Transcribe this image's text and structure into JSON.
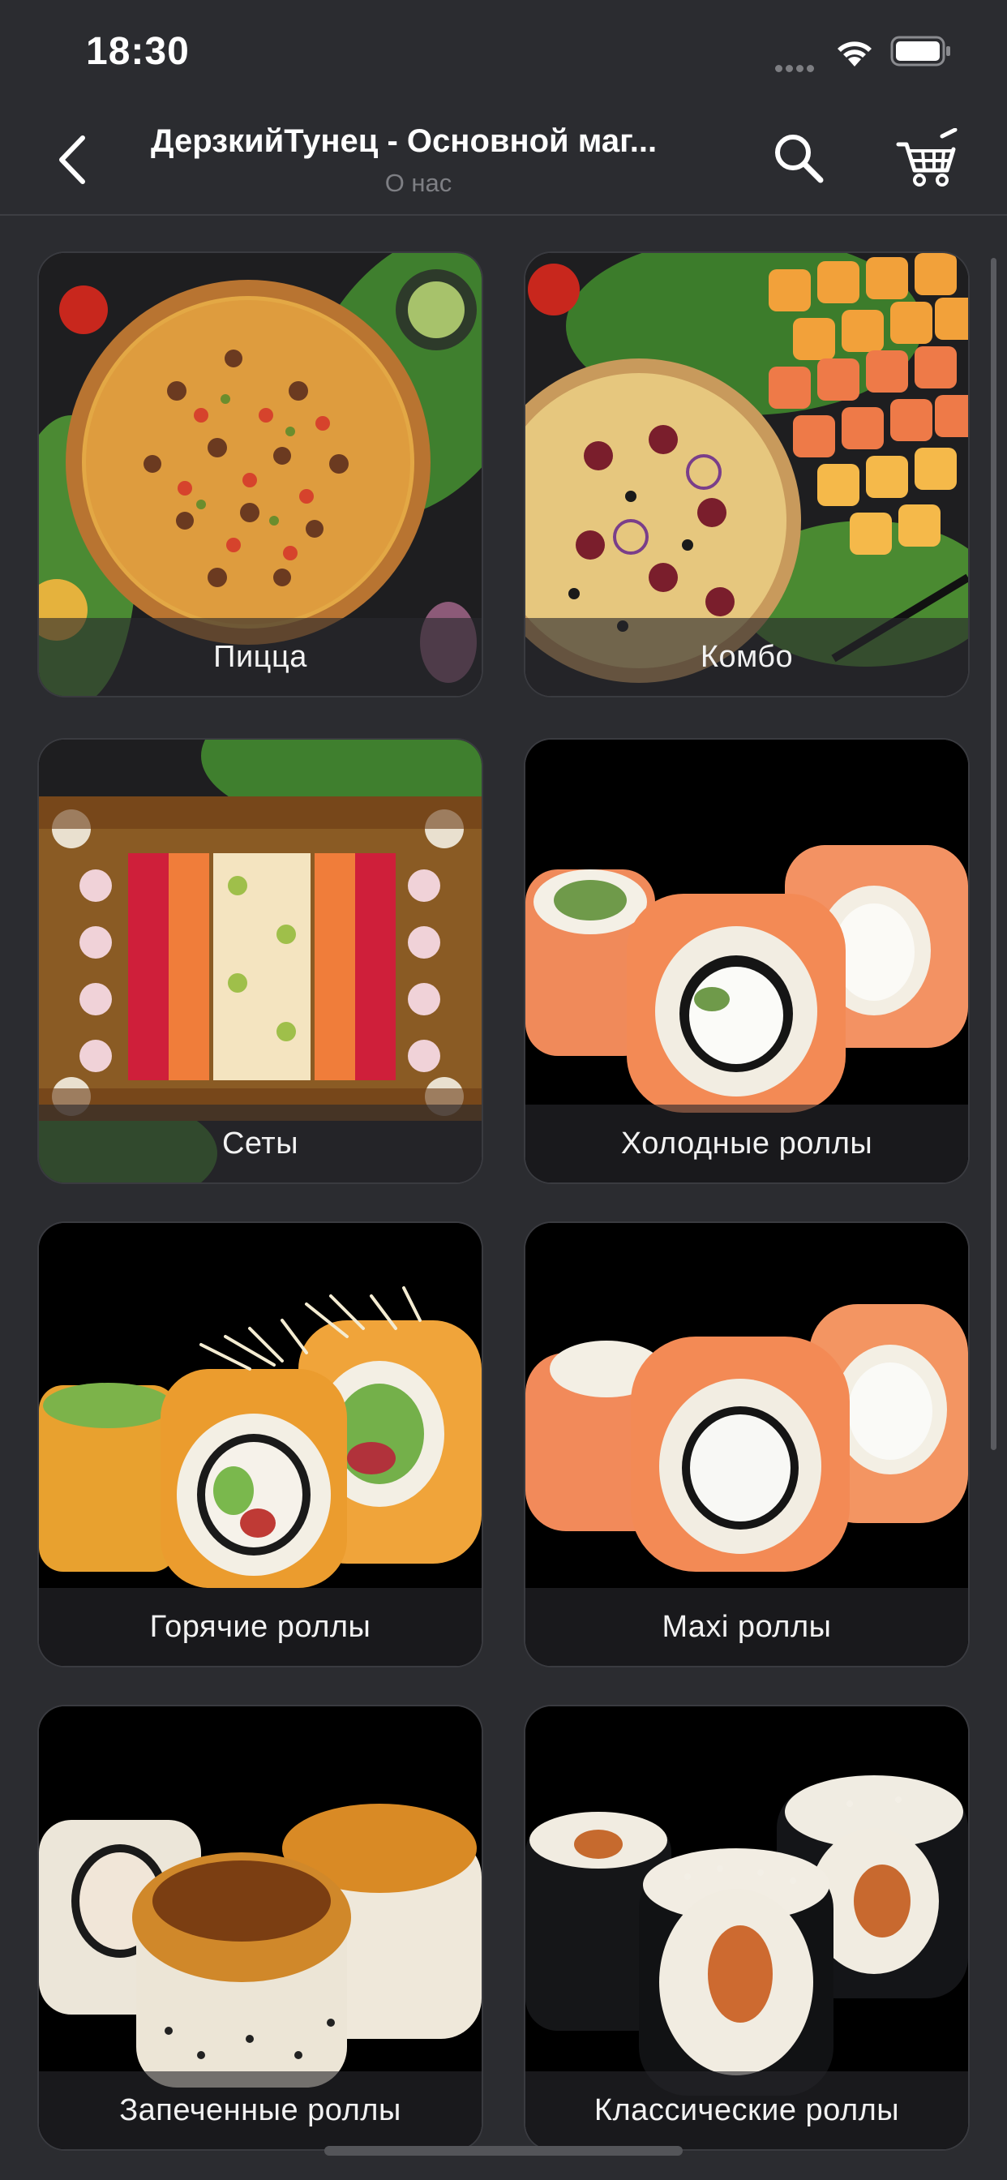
{
  "status_bar": {
    "time": "18:30"
  },
  "nav": {
    "title": "ДерзкийТунец - Основной маг...",
    "subtitle": "О нас"
  },
  "categories": [
    {
      "label": "Пицца"
    },
    {
      "label": "Комбо"
    },
    {
      "label": "Сеты"
    },
    {
      "label": "Холодные роллы"
    },
    {
      "label": "Горячие роллы"
    },
    {
      "label": "Maxi роллы"
    },
    {
      "label": "Запеченные роллы"
    },
    {
      "label": "Классические роллы"
    }
  ],
  "colors": {
    "background": "#2b2c30",
    "card_border": "#3a3b40",
    "subtitle": "#7e7f84"
  },
  "icons": [
    "back-chevron-icon",
    "search-icon",
    "cart-icon",
    "wifi-icon",
    "battery-icon",
    "signal-icon"
  ]
}
